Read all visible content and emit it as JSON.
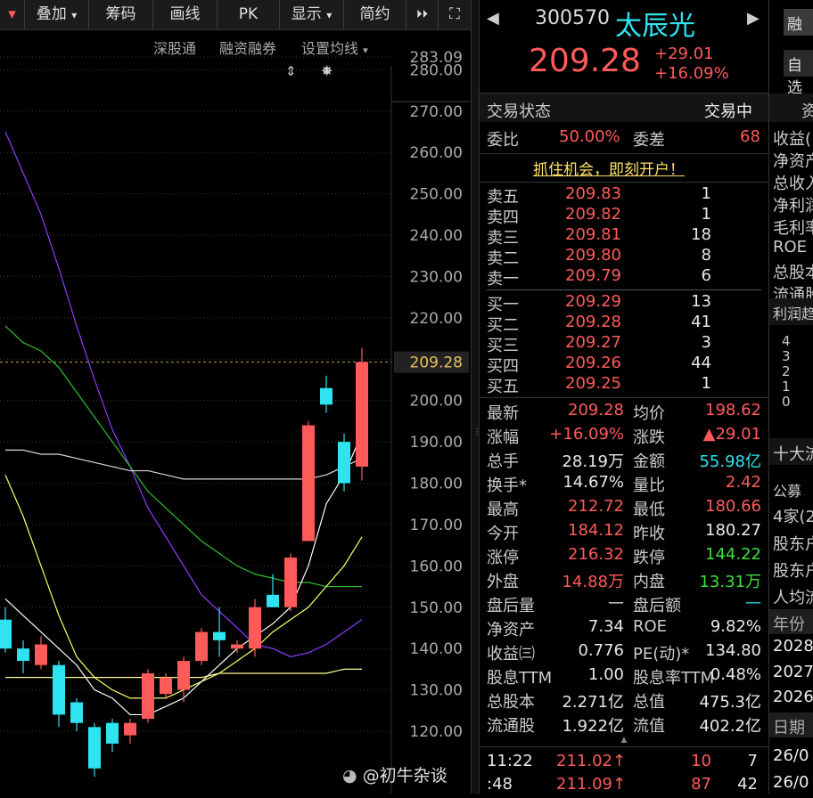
{
  "toolbar": {
    "items": [
      {
        "label": "叠加",
        "caret": "▾"
      },
      {
        "label": "筹码"
      },
      {
        "label": "画线"
      },
      {
        "label": "PK"
      },
      {
        "label": "显示",
        "caret": "▾"
      },
      {
        "label": "简约"
      }
    ],
    "edge_caret": "▾",
    "more_icon": "⏵⏵",
    "expand_icon": "⛶"
  },
  "chart_links": {
    "shsz": "深股通",
    "margin": "融资融券",
    "ma_settings": "设置均线"
  },
  "chart_data": {
    "type": "candlestick",
    "ylim": [
      120,
      283.09
    ],
    "ticks": [
      "283.09",
      "280.00",
      "270.00",
      "260.00",
      "250.00",
      "240.00",
      "230.00",
      "220.00",
      "210.00",
      "200.00",
      "190.00",
      "180.00",
      "170.00",
      "160.00",
      "150.00",
      "140.00",
      "130.00",
      "120.00"
    ],
    "tick_values": [
      283.09,
      280,
      270,
      260,
      250,
      240,
      230,
      220,
      210,
      200,
      190,
      180,
      170,
      160,
      150,
      140,
      130,
      120
    ],
    "last_price": "209.28",
    "last_value": 209.28,
    "candles": [
      {
        "o": 147,
        "c": 140,
        "h": 150,
        "l": 139,
        "up": false
      },
      {
        "o": 140,
        "c": 137,
        "h": 142,
        "l": 134,
        "up": false
      },
      {
        "o": 141,
        "c": 136,
        "h": 143,
        "l": 135,
        "up": true
      },
      {
        "o": 136,
        "c": 124,
        "h": 137,
        "l": 121,
        "up": false
      },
      {
        "o": 127,
        "c": 122,
        "h": 128,
        "l": 120,
        "up": false
      },
      {
        "o": 121,
        "c": 111,
        "h": 122,
        "l": 109,
        "up": false
      },
      {
        "o": 122,
        "c": 117,
        "h": 123,
        "l": 115,
        "up": false
      },
      {
        "o": 119,
        "c": 122,
        "h": 123,
        "l": 117,
        "up": true
      },
      {
        "o": 123,
        "c": 134,
        "h": 135,
        "l": 122,
        "up": true
      },
      {
        "o": 129,
        "c": 133,
        "h": 134,
        "l": 128,
        "up": true
      },
      {
        "o": 130,
        "c": 137,
        "h": 138,
        "l": 127,
        "up": true
      },
      {
        "o": 137,
        "c": 144,
        "h": 145,
        "l": 136,
        "up": true
      },
      {
        "o": 144,
        "c": 142,
        "h": 150,
        "l": 138,
        "up": false
      },
      {
        "o": 140,
        "c": 141,
        "h": 142,
        "l": 139,
        "up": true
      },
      {
        "o": 140,
        "c": 150,
        "h": 152,
        "l": 138,
        "up": true
      },
      {
        "o": 150,
        "c": 153,
        "h": 158,
        "l": 150,
        "up": false
      },
      {
        "o": 150,
        "c": 162,
        "h": 163,
        "l": 149,
        "up": true
      },
      {
        "o": 166,
        "c": 194,
        "h": 195,
        "l": 170,
        "up": true
      },
      {
        "o": 203,
        "c": 199,
        "h": 206,
        "l": 197,
        "up": false
      },
      {
        "o": 190,
        "c": 180,
        "h": 192,
        "l": 178,
        "up": false
      },
      {
        "o": 184,
        "c": 209.28,
        "h": 212.72,
        "l": 180.66,
        "up": true
      }
    ],
    "ma_lines": [
      {
        "color": "#8c3cff",
        "values": [
          265,
          255,
          245,
          232,
          218,
          205,
          193,
          184,
          174,
          167,
          160,
          153,
          149,
          145,
          141,
          140,
          138,
          139,
          141,
          144,
          147
        ]
      },
      {
        "color": "#2fbf2f",
        "values": [
          218,
          214,
          212,
          208,
          202,
          196,
          190,
          184,
          178,
          174,
          170,
          166,
          163,
          160,
          158,
          157,
          156,
          156,
          155,
          155,
          155
        ]
      },
      {
        "color": "#ffff66",
        "values": [
          182,
          172,
          160,
          148,
          138,
          133,
          130,
          128,
          128,
          128,
          130,
          132,
          134,
          137,
          140,
          144,
          147,
          150,
          155,
          160,
          167
        ]
      },
      {
        "color": "#d8d8d8",
        "values": [
          188,
          188,
          187,
          187,
          186,
          185,
          184,
          183,
          183,
          182,
          181,
          181,
          181,
          181,
          181,
          181,
          181,
          181,
          182,
          184,
          186
        ]
      },
      {
        "color": "#ffff99",
        "values": [
          133,
          133,
          133,
          133,
          133,
          133,
          133,
          133,
          133,
          133,
          133,
          133,
          134,
          134,
          134,
          134,
          134,
          134,
          134,
          135,
          135
        ]
      },
      {
        "color": "#ffffff",
        "values": [
          152,
          148,
          144,
          140,
          136,
          130,
          128,
          124,
          124,
          126,
          128,
          132,
          136,
          140,
          143,
          146,
          150,
          160,
          175,
          182,
          192
        ]
      }
    ]
  },
  "quote": {
    "code": "300570",
    "name": "太辰光",
    "price": "209.28",
    "change": "+29.01",
    "change_pct": "+16.09%",
    "status_label": "交易状态",
    "status_value": "交易中",
    "ratio_label": "委比",
    "ratio_value": "50.00%",
    "diff_label": "委差",
    "diff_value": "68",
    "promo": "抓住机会，即刻开户！",
    "asks": [
      {
        "label": "卖五",
        "price": "209.83",
        "vol": "1"
      },
      {
        "label": "卖四",
        "price": "209.82",
        "vol": "1"
      },
      {
        "label": "卖三",
        "price": "209.81",
        "vol": "18"
      },
      {
        "label": "卖二",
        "price": "209.80",
        "vol": "8"
      },
      {
        "label": "卖一",
        "price": "209.79",
        "vol": "6"
      }
    ],
    "bids": [
      {
        "label": "买一",
        "price": "209.29",
        "vol": "13"
      },
      {
        "label": "买二",
        "price": "209.28",
        "vol": "41"
      },
      {
        "label": "买三",
        "price": "209.27",
        "vol": "3"
      },
      {
        "label": "买四",
        "price": "209.26",
        "vol": "44"
      },
      {
        "label": "买五",
        "price": "209.25",
        "vol": "1"
      }
    ],
    "stats": [
      [
        {
          "l": "最新",
          "v": "209.28",
          "c": "red"
        },
        {
          "l": "均价",
          "v": "198.62",
          "c": "red"
        }
      ],
      [
        {
          "l": "涨幅",
          "v": "+16.09%",
          "c": "red"
        },
        {
          "l": "涨跌",
          "v": "▲29.01",
          "c": "red"
        }
      ],
      [
        {
          "l": "总手",
          "v": "28.19万",
          "c": "white"
        },
        {
          "l": "金额",
          "v": "55.98亿",
          "c": "cyan"
        }
      ],
      [
        {
          "l": "换手*",
          "v": "14.67%",
          "c": "white"
        },
        {
          "l": "量比",
          "v": "2.42",
          "c": "red"
        }
      ],
      [
        {
          "l": "最高",
          "v": "212.72",
          "c": "red"
        },
        {
          "l": "最低",
          "v": "180.66",
          "c": "red"
        }
      ],
      [
        {
          "l": "今开",
          "v": "184.12",
          "c": "red"
        },
        {
          "l": "昨收",
          "v": "180.27",
          "c": "white"
        }
      ],
      [
        {
          "l": "涨停",
          "v": "216.32",
          "c": "red"
        },
        {
          "l": "跌停",
          "v": "144.22",
          "c": "green"
        }
      ],
      [
        {
          "l": "外盘",
          "v": "14.88万",
          "c": "red"
        },
        {
          "l": "内盘",
          "v": "13.31万",
          "c": "green"
        }
      ],
      [
        {
          "l": "盘后量",
          "v": "—",
          "c": "white"
        },
        {
          "l": "盘后额",
          "v": "—",
          "c": "cyan"
        }
      ],
      [
        {
          "l": "净资产",
          "v": "7.34",
          "c": "white"
        },
        {
          "l": "ROE",
          "v": "9.82%",
          "c": "white"
        }
      ],
      [
        {
          "l": "收益㈢",
          "v": "0.776",
          "c": "white"
        },
        {
          "l": "PE(动)*",
          "v": "134.80",
          "c": "white"
        }
      ],
      [
        {
          "l": "股息TTM",
          "v": "1.00",
          "c": "white"
        },
        {
          "l": "股息率TTM",
          "v": "0.48%",
          "c": "white"
        }
      ],
      [
        {
          "l": "总股本",
          "v": "2.271亿",
          "c": "white"
        },
        {
          "l": "总值",
          "v": "475.3亿",
          "c": "white"
        }
      ],
      [
        {
          "l": "流通股",
          "v": "1.922亿",
          "c": "white"
        },
        {
          "l": "流值",
          "v": "402.2亿",
          "c": "white"
        }
      ]
    ],
    "ticks": [
      {
        "time": "11:22",
        "price": "211.02↑",
        "vol": "10",
        "n": "7"
      },
      {
        "time": ":48",
        "price": "211.09↑",
        "vol": "87",
        "n": "42"
      }
    ],
    "expand_caret": "▲"
  },
  "right_panel": {
    "btn1": "融",
    "btn2": "自选",
    "tab": "资",
    "labels": [
      "收益(",
      "净资产",
      "总收入",
      "净利润",
      "毛利率",
      "ROE",
      "总股本",
      "流通股"
    ],
    "profit": "利润趋",
    "bars": [
      "4",
      "3",
      "2",
      "1",
      "0"
    ],
    "top10": "十大流",
    "notice": "公募",
    "org": "4家(2",
    "holder1": "股东户",
    "holder2": "股东户",
    "avg": "人均流",
    "year": "年份",
    "years": [
      "2028",
      "2027",
      "2026"
    ],
    "date": "日期",
    "dates": [
      "26/0",
      "26/0"
    ]
  },
  "watermark": "@初牛杂谈"
}
